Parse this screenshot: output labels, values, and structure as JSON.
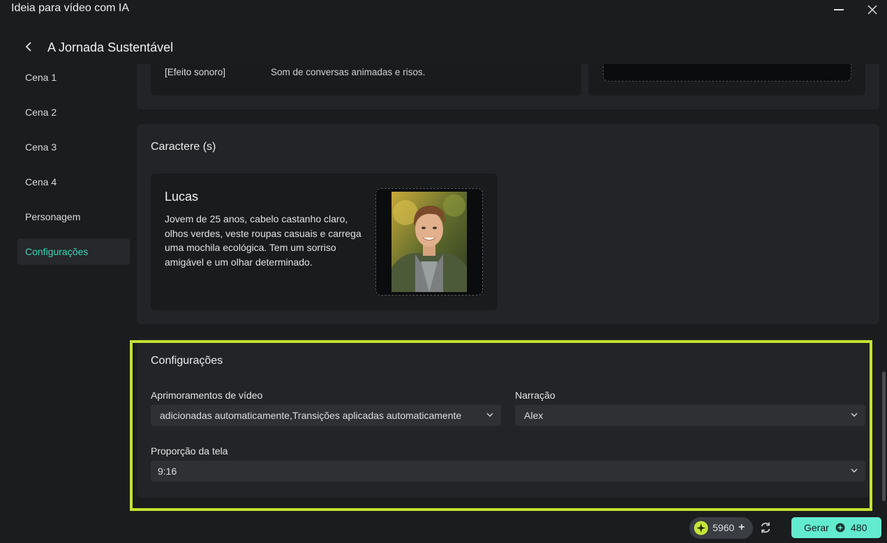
{
  "window": {
    "title": "Ideia para vídeo com IA"
  },
  "header": {
    "title": "A Jornada Sustentável"
  },
  "sidebar": {
    "items": [
      {
        "label": "Cena 1"
      },
      {
        "label": "Cena 2"
      },
      {
        "label": "Cena 3"
      },
      {
        "label": "Cena 4"
      },
      {
        "label": "Personagem"
      },
      {
        "label": "Configurações"
      }
    ],
    "active": "Configurações"
  },
  "scene": {
    "sound_effect_label": "[Efeito sonoro]",
    "sound_effect_text": "Som de conversas animadas e risos."
  },
  "characters": {
    "title": "Caractere (s)",
    "items": [
      {
        "name": "Lucas",
        "description": "Jovem de 25 anos, cabelo castanho claro, olhos verdes, veste roupas casuais e carrega uma mochila ecológica. Tem um sorriso amigável e um olhar determinado."
      }
    ]
  },
  "settings": {
    "title": "Configurações",
    "video_enhancements_label": "Aprimoramentos de vídeo",
    "video_enhancements_value": "adicionadas automaticamente,Transições aplicadas automaticamente",
    "narration_label": "Narração",
    "narration_value": "Alex",
    "aspect_ratio_label": "Proporção da tela",
    "aspect_ratio_value": "9:16"
  },
  "footer": {
    "credits": "5960",
    "generate_label": "Gerar",
    "generate_cost": "480"
  },
  "colors": {
    "accent": "#39d7b8",
    "button_bg": "#63ebd0",
    "highlight": "#c3e233"
  }
}
